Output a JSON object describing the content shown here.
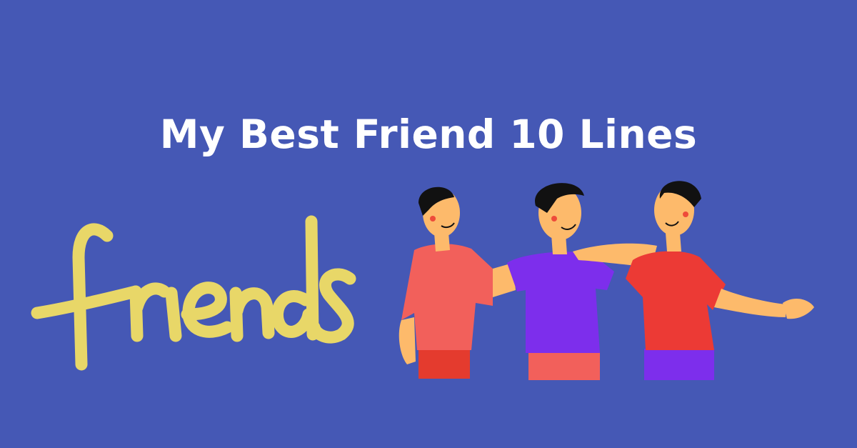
{
  "banner": {
    "title": "My Best Friend 10 Lines",
    "lettering_text": "friends"
  },
  "colors": {
    "background": "#4558B5",
    "title": "#FFFFFF",
    "lettering": "#E8D768",
    "skin": "#FDBA6B",
    "hair": "#111111",
    "shirt_left": "#F2605B",
    "shirt_middle": "#7D2EEC",
    "shirt_right": "#EC3A35",
    "pants_left": "#E43B2E",
    "pants_middle": "#F2605B",
    "pants_right": "#7D2EEC",
    "cheeks": "#EE4B3A"
  }
}
